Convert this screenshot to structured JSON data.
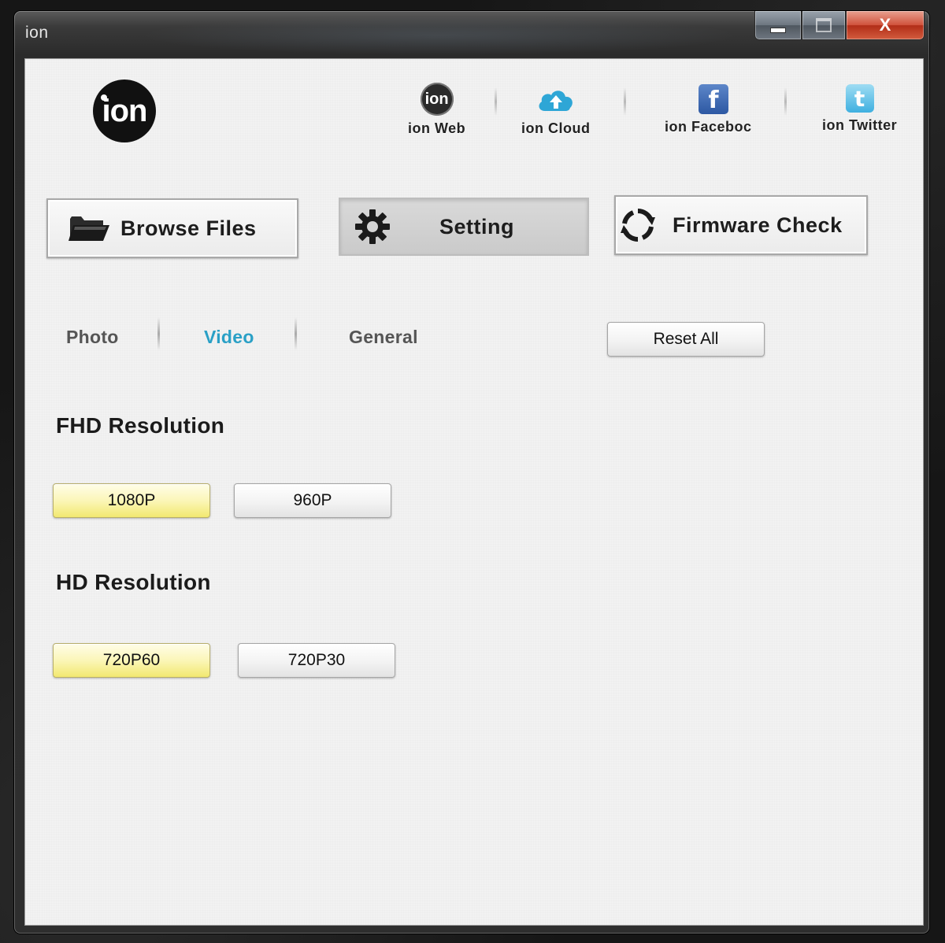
{
  "window": {
    "title": "ion",
    "minimize_label": "",
    "maximize_label": "",
    "close_label": "X"
  },
  "logo": {
    "text": "ion"
  },
  "top_links": [
    {
      "label": "ion Web",
      "icon": "ion-web-icon"
    },
    {
      "label": "ion Cloud",
      "icon": "cloud-upload-icon"
    },
    {
      "label": "ion Faceboc",
      "icon": "facebook-icon"
    },
    {
      "label": "ion Twitter",
      "icon": "twitter-icon"
    }
  ],
  "main_buttons": {
    "browse_files": "Browse Files",
    "setting": "Setting",
    "firmware_check": "Firmware Check"
  },
  "tabs": {
    "photo": "Photo",
    "video": "Video",
    "general": "General",
    "active": "Video"
  },
  "reset_all": "Reset All",
  "fhd": {
    "title": "FHD Resolution",
    "options": [
      "1080P",
      "960P"
    ],
    "selected": "1080P"
  },
  "hd": {
    "title": "HD Resolution",
    "options": [
      "720P60",
      "720P30"
    ],
    "selected": "720P60"
  },
  "colors": {
    "active_tab": "#2aa0c6",
    "selected_option": "#f2e870",
    "close_button": "#c83c22"
  }
}
